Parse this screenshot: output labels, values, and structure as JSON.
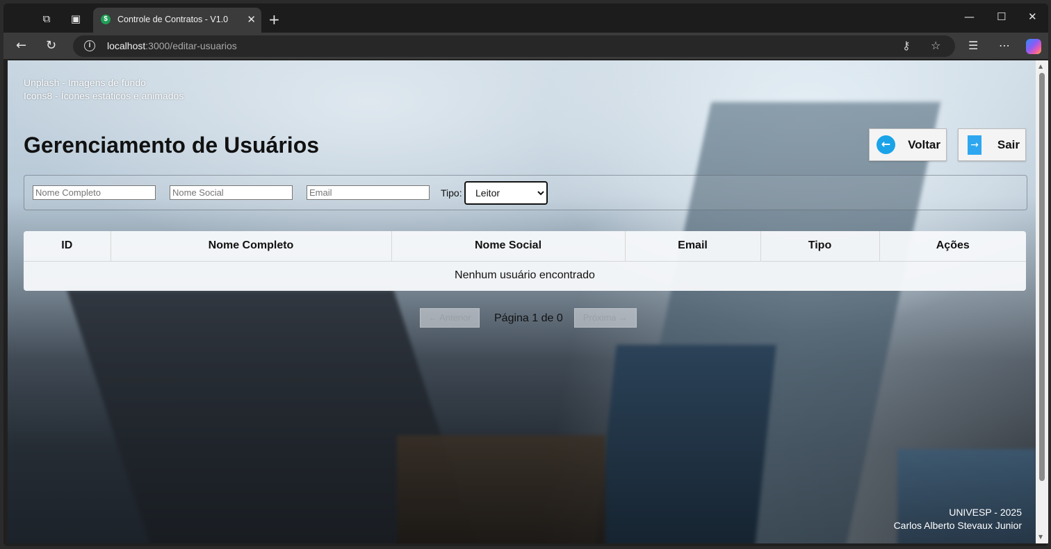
{
  "browser": {
    "tab_title": "Controle de Contratos - V1.0",
    "tab_favicon": "$",
    "url_host": "localhost",
    "url_path": ":3000/editar-usuarios"
  },
  "credits": {
    "line1": "Unplash - Imagens de fundo",
    "line2": "Icons8 - Ícones estáticos e animados"
  },
  "page": {
    "title": "Gerenciamento de Usuários"
  },
  "actions": {
    "voltar_label": "Voltar",
    "sair_label": "Sair"
  },
  "filters": {
    "nome_completo_placeholder": "Nome Completo",
    "nome_social_placeholder": "Nome Social",
    "email_placeholder": "Email",
    "tipo_label": "Tipo:",
    "tipo_selected": "Leitor"
  },
  "table": {
    "headers": [
      "ID",
      "Nome Completo",
      "Nome Social",
      "Email",
      "Tipo",
      "Ações"
    ],
    "empty_message": "Nenhum usuário encontrado"
  },
  "pagination": {
    "prev_label": "← Anterior",
    "next_label": "Próxima →",
    "page_text": "Página 1 de 0"
  },
  "footer": {
    "line1": "UNIVESP - 2025",
    "line2": "Carlos Alberto Stevaux Junior"
  },
  "colors": {
    "accent_blue": "#1aa3e8",
    "favicon_green": "#1e9e55"
  }
}
